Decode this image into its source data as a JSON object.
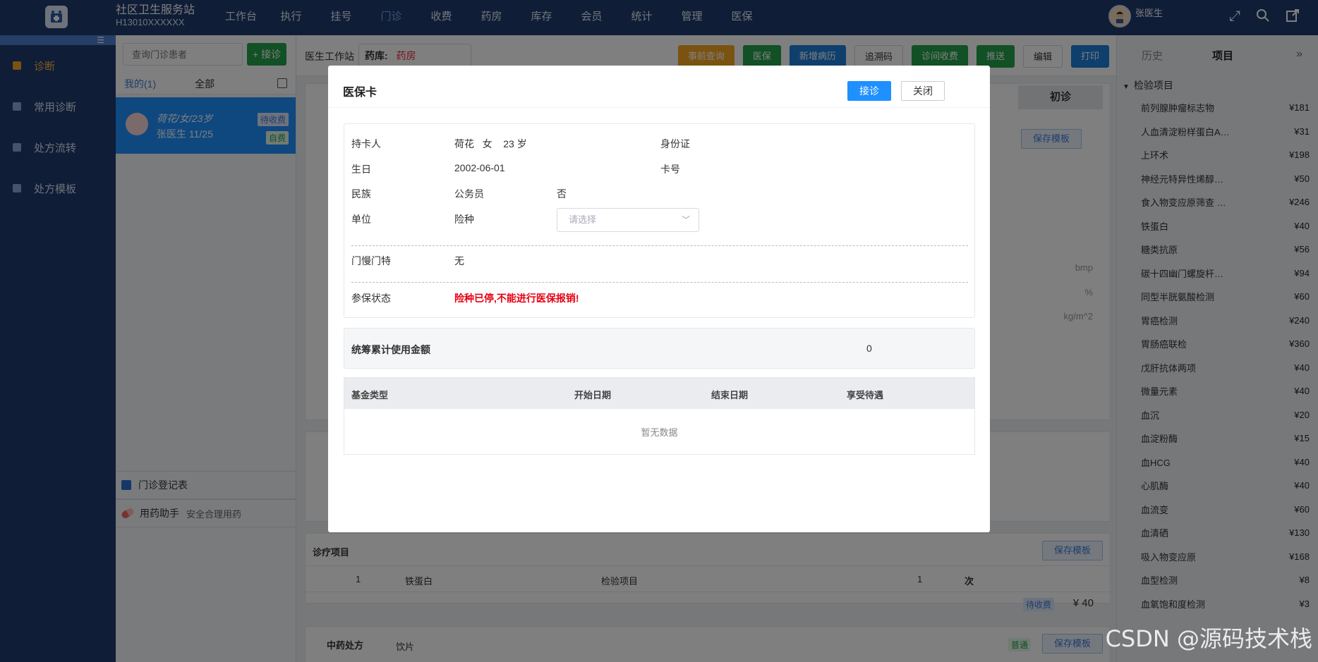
{
  "app": {
    "title": "社区卫生服务站",
    "code": "H13010XXXXXX"
  },
  "nav": [
    "工作台",
    "执行",
    "挂号",
    "门诊",
    "收费",
    "药房",
    "库存",
    "会员",
    "统计",
    "管理",
    "医保"
  ],
  "user": {
    "name": "张医生"
  },
  "sidebar": {
    "items": [
      "诊断",
      "常用诊断",
      "处方流转",
      "处方模板"
    ]
  },
  "patient_panel": {
    "search_placeholder": "查询门诊患者",
    "add_label": "+ 接诊",
    "tab_mine": "我的(1)",
    "tab_all": "全部",
    "patient": {
      "line1": "荷花/女/23岁",
      "line2": "张医生   11/25",
      "status": "待收费",
      "fee_type": "自费"
    },
    "register_label": "门诊登记表",
    "assistant_label": "用药助手",
    "assistant_sub": "安全合理用药"
  },
  "workspace": {
    "station_label": "医生工作站",
    "pharmacy_label": "药库:",
    "pharmacy_value": "药房",
    "buttons": [
      "事前查询",
      "医保",
      "新增病历",
      "追溯码",
      "诊间收费",
      "推送",
      "编辑",
      "打印"
    ],
    "diag_tab_initial": "初诊",
    "save_template": "保存模板",
    "units": [
      "bmp",
      "%",
      "kg/m^2"
    ],
    "project_section": "诊疗项目",
    "project_row": {
      "index": "1",
      "name": "铁蛋白",
      "category": "检验项目",
      "qty": "1",
      "unit": "次"
    },
    "project_status": "待收费",
    "project_amount": "¥ 40",
    "tcm_label": "中药处方",
    "tcm_type": "饮片",
    "tcm_badge": "普通"
  },
  "right_panel": {
    "tab_history": "历史",
    "tab_items": "项目",
    "group": "检验项目",
    "items": [
      {
        "name": "前列腺肿瘤标志物",
        "price": "¥181"
      },
      {
        "name": "人血清淀粉样蛋白A…",
        "price": "¥31"
      },
      {
        "name": "上环术",
        "price": "¥198"
      },
      {
        "name": "神经元特异性烯醇…",
        "price": "¥50"
      },
      {
        "name": "食入物变应原筛查 …",
        "price": "¥246"
      },
      {
        "name": "铁蛋白",
        "price": "¥40"
      },
      {
        "name": "糖类抗原",
        "price": "¥56"
      },
      {
        "name": "碳十四幽门螺旋杆…",
        "price": "¥94"
      },
      {
        "name": "同型半胱氨酸检测",
        "price": "¥60"
      },
      {
        "name": "胃癌检测",
        "price": "¥240"
      },
      {
        "name": "胃肠癌联检",
        "price": "¥360"
      },
      {
        "name": "戊肝抗体两项",
        "price": "¥40"
      },
      {
        "name": "微量元素",
        "price": "¥40"
      },
      {
        "name": "血沉",
        "price": "¥20"
      },
      {
        "name": "血淀粉酶",
        "price": "¥15"
      },
      {
        "name": "血HCG",
        "price": "¥40"
      },
      {
        "name": "心肌酶",
        "price": "¥40"
      },
      {
        "name": "血流变",
        "price": "¥60"
      },
      {
        "name": "血清硒",
        "price": "¥130"
      },
      {
        "name": "吸入物变应原",
        "price": "¥168"
      },
      {
        "name": "血型检测",
        "price": "¥8"
      },
      {
        "name": "血氧饱和度检测",
        "price": "¥3"
      }
    ]
  },
  "modal": {
    "title": "医保卡",
    "ok_label": "接诊",
    "close_label": "关闭",
    "holder_label": "持卡人",
    "holder_value": "荷花   女    23 岁",
    "id_label": "身份证",
    "birth_label": "生日",
    "birth_value": "2002-06-01",
    "card_label": "卡号",
    "ethnic_label": "民族",
    "civil_label": "公务员",
    "civil_value": "否",
    "unit_label": "单位",
    "insurance_label": "险种",
    "insurance_placeholder": "请选择",
    "chronic_label": "门慢门特",
    "chronic_value": "无",
    "status_label": "参保状态",
    "status_value": "险种已停,不能进行医保报销!",
    "pool_label": "统筹累计使用金额",
    "pool_value": "0",
    "table_headers": [
      "基金类型",
      "开始日期",
      "结束日期",
      "享受待遇"
    ],
    "empty_text": "暂无数据"
  },
  "watermark": "CSDN @源码技术栈"
}
